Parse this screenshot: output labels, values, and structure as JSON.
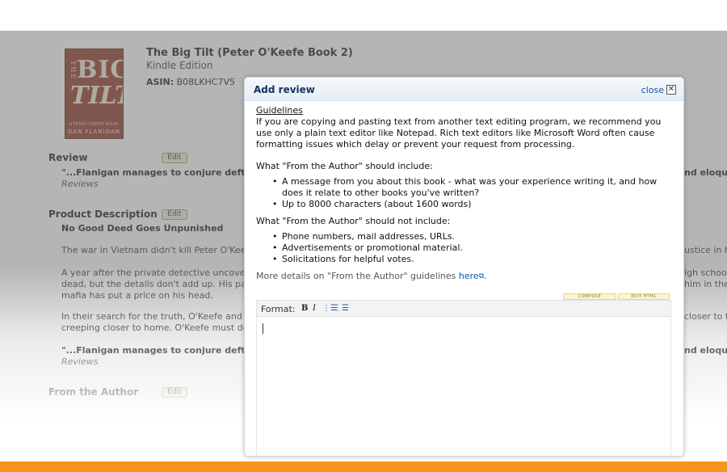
{
  "book": {
    "cover": {
      "word_the": "THE",
      "word_big": "BIG",
      "word_tilt": "TILT",
      "tagline": "A PETER O'KEEFE NOVEL",
      "author": "DAN FLANIGAN",
      "color": "#8b2f1c"
    },
    "title": "The Big Tilt (Peter O'Keefe Book 2)",
    "format": "Kindle Edition",
    "asin_label": "ASIN:",
    "asin_value": "B08LKHC7V5"
  },
  "sections": {
    "review": {
      "heading": "Review",
      "edit_label": "Edit",
      "quote": "\"...Flanigan manages to conjure deft, l",
      "quote_right": "nd eloqu",
      "source": "Reviews"
    },
    "description": {
      "heading": "Product Description",
      "edit_label": "Edit",
      "subhead": "No Good Deed Goes Unpunished",
      "para1": "The war in Vietnam didn't kill Peter O'Keefe",
      "para1_right": "ustice in h",
      "para2_l1": "A year after the private detective uncovere",
      "para2_l1_right": "igh school",
      "para2_l2": "dead, but the details don't add up. His pal,",
      "para2_l2_right": "him in the",
      "para2_l3": "mafia has put a price on his head.",
      "para3_l1": "In their search for the truth, O'Keefe and i",
      "para3_l1_right": "closer to t",
      "para3_l2": "creeping closer to home. O'Keefe must de",
      "quote": "\"...Flanigan manages to conjure deft, l",
      "quote_right": "nd eloqu",
      "source": "Reviews"
    },
    "author": {
      "heading": "From the Author",
      "edit_label": "Edit"
    }
  },
  "modal": {
    "title": "Add review",
    "close_label": "close",
    "close_glyph": "✕",
    "guidelines_heading": "Guidelines",
    "guidelines_text": "If you are copying and pasting text from another text editing program, we recommend you use only a plain text editor like Notepad. Rich text editors like Microsoft Word often cause formatting issues which delay or prevent your request from processing.",
    "should_include_heading": "What \"From the Author\" should include:",
    "should_include": [
      "A message from you about this book - what was your experience writing it, and how does it relate to other books you've written?",
      "Up to 8000 characters (about 1600 words)"
    ],
    "should_not_include_heading": "What \"From the Author\" should not include:",
    "should_not_include": [
      "Phone numbers, mail addresses, URLs.",
      "Advertisements or promotional material.",
      "Solicitations for helpful votes."
    ],
    "more_details_text": "More details on \"From the Author\" guidelines",
    "more_details_link": "here",
    "more_details_end": ".",
    "tabs": {
      "compose": "COMPOSE",
      "edit_html": "EDIT HTML"
    },
    "editor": {
      "format_label": "Format:",
      "bold": "B",
      "italic": "I",
      "numbered_list": "⋮☰",
      "bulleted_list": "⋮☰",
      "value": ""
    }
  },
  "colors": {
    "accent_orange": "#f7941d",
    "link_blue": "#0b5ba8",
    "modal_title": "#14325e",
    "edit_button_green": "#e9f1d9"
  }
}
